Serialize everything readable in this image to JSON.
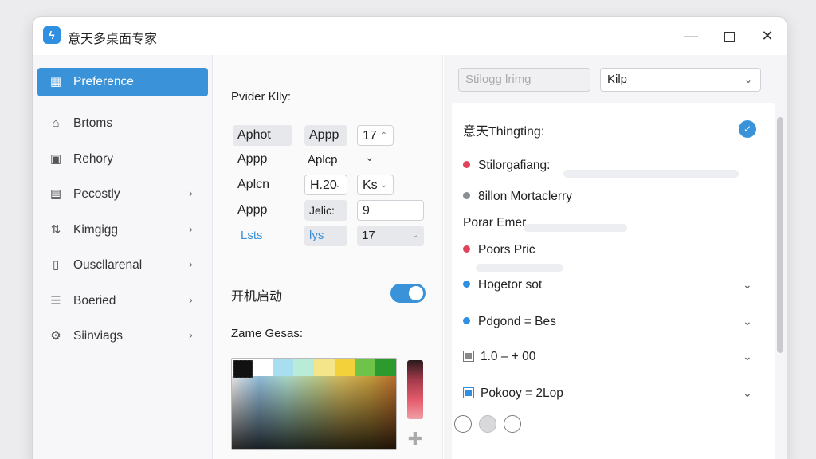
{
  "window": {
    "title": "意天多桌面专家"
  },
  "sidebar": {
    "items": [
      {
        "label": "Preference",
        "icon": "grid-icon",
        "active": true,
        "chevron": false
      },
      {
        "label": "Brtoms",
        "icon": "home-icon",
        "active": false,
        "chevron": false
      },
      {
        "label": "Rehory",
        "icon": "calendar-icon",
        "active": false,
        "chevron": false
      },
      {
        "label": "Pecostly",
        "icon": "box-icon",
        "active": false,
        "chevron": true
      },
      {
        "label": "Kimgigg",
        "icon": "sliders-icon",
        "active": false,
        "chevron": true
      },
      {
        "label": "Ouscllarenal",
        "icon": "document-icon",
        "active": false,
        "chevron": true
      },
      {
        "label": "Boeried",
        "icon": "list-icon",
        "active": false,
        "chevron": true
      },
      {
        "label": "Siinviags",
        "icon": "gear-icon",
        "active": false,
        "chevron": true
      }
    ]
  },
  "middle": {
    "heading": "Pvider Klly:",
    "grid": {
      "r1c1": "Aphot",
      "r1c2": "Appp",
      "r1c3": "17",
      "r2c1": "Appp",
      "r2c2": "Aplcp",
      "r3c1": "Aplcn",
      "r3c2": "H.20",
      "r3c3": "Ks",
      "r4c1": "Appp",
      "r4c2": "Jelic:",
      "r4c3": "9",
      "r5c1": "Lsts",
      "r5c2": "lys",
      "r5c3": "17"
    },
    "startup_label": "开机启动",
    "startup_on": true,
    "color_section_label": "Zame Gesas:",
    "swatches": [
      "#ffffff",
      "#ffffff",
      "#a8dff0",
      "#b8ecd8",
      "#f4e58a",
      "#f2d13a",
      "#6fc24a",
      "#2c9a2c"
    ],
    "hue_colors": [
      "#2a1a1c",
      "#e45a6a",
      "#f0a0a8"
    ]
  },
  "right": {
    "search_placeholder": "Stilogg lrimg",
    "select_value": "Kilp",
    "section_title": "意天Thingting:",
    "rows": [
      {
        "label": "Stilorgafiang:",
        "marker": "dot-red"
      },
      {
        "label": "8illon Mortaclerry",
        "marker": "dot-grey"
      },
      {
        "label": "Porar Emer",
        "marker": "none"
      },
      {
        "label": "Poors Pric",
        "marker": "dot-red"
      },
      {
        "label": "Hogetor sot",
        "marker": "dot-blue",
        "chevron": true
      },
      {
        "label": "Pdgond = Bes",
        "marker": "dot-blue",
        "chevron": true
      },
      {
        "label": "1.0 – + 00",
        "marker": "sq-filled",
        "chevron": true
      },
      {
        "label": "Pokooy = 2Lop",
        "marker": "sq-blue",
        "chevron": true
      }
    ],
    "colors": {
      "accent": "#3a93d8",
      "red": "#e0445a"
    }
  }
}
